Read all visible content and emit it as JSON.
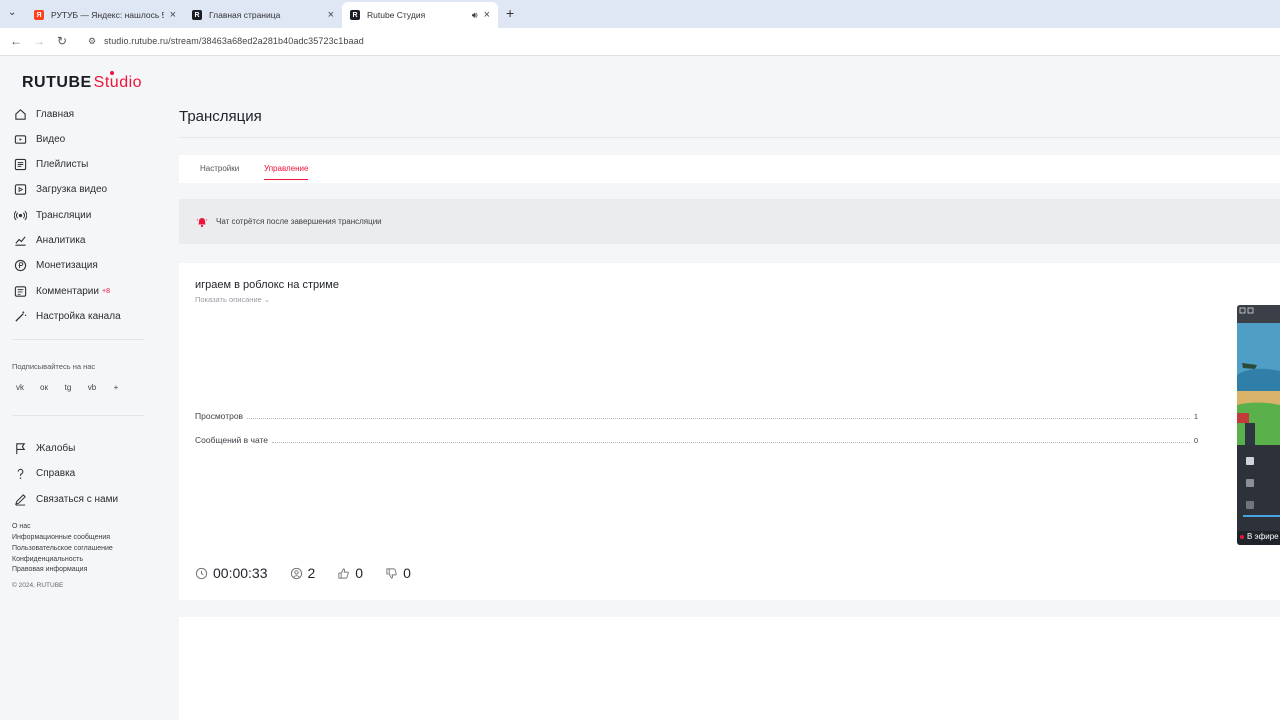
{
  "browser": {
    "tabs": [
      {
        "title": "РУТУБ — Яндекс: нашлось 5 т",
        "favicon_color": "#fc3f1d",
        "favicon_letter": "Я"
      },
      {
        "title": "Главная страница",
        "favicon_color": "#1a1d24",
        "favicon_letter": "R"
      },
      {
        "title": "Rutube Студия",
        "favicon_color": "#1a1d24",
        "favicon_letter": "R",
        "active": true
      }
    ],
    "url": "studio.rutube.ru/stream/38463a68ed2a281b40adc35723c1baad"
  },
  "logo": {
    "main": "RUTUBE",
    "sub": "Studio"
  },
  "sidebar": {
    "items": [
      {
        "label": "Главная",
        "icon": "home-icon"
      },
      {
        "label": "Видео",
        "icon": "video-icon"
      },
      {
        "label": "Плейлисты",
        "icon": "playlist-icon"
      },
      {
        "label": "Загрузка видео",
        "icon": "upload-icon"
      },
      {
        "label": "Трансляции",
        "icon": "broadcast-icon"
      },
      {
        "label": "Аналитика",
        "icon": "analytics-icon"
      },
      {
        "label": "Монетизация",
        "icon": "monetization-icon"
      },
      {
        "label": "Комментарии",
        "icon": "comments-icon",
        "badge": "+8"
      },
      {
        "label": "Настройка канала",
        "icon": "wand-icon"
      }
    ],
    "follow_label": "Подписывайтесь на нас",
    "social": [
      "vk",
      "ок",
      "tg",
      "vb",
      "+"
    ],
    "support_items": [
      {
        "label": "Жалобы",
        "icon": "flag-icon"
      },
      {
        "label": "Справка",
        "icon": "help-icon"
      },
      {
        "label": "Связаться с нами",
        "icon": "pen-icon"
      }
    ],
    "footer_links": [
      "О нас",
      "Информационные сообщения",
      "Пользовательское соглашение",
      "Конфиденциальность",
      "Правовая информация"
    ],
    "copyright": "© 2024, RUTUBE"
  },
  "main": {
    "title": "Трансляция",
    "tabs": [
      "Настройки",
      "Управление"
    ],
    "notice": "Чат сотрётся после завершения трансляции",
    "stream": {
      "title": "играем в роблокс на стриме",
      "show_description": "Показать описание",
      "stats": [
        {
          "label": "Просмотров",
          "value": "1"
        },
        {
          "label": "Сообщений в чате",
          "value": "0"
        }
      ],
      "metrics": {
        "duration": "00:00:33",
        "viewers": "2",
        "likes": "0",
        "dislikes": "0"
      },
      "live_label": "В эфире"
    }
  },
  "colors": {
    "accent": "#ed143b"
  }
}
